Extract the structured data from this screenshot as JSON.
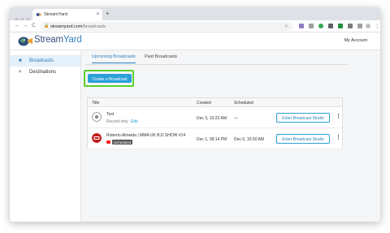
{
  "browser": {
    "tab_title": "StreamYard",
    "tab_close": "×",
    "new_tab": "+",
    "url_domain": "streamyard.com",
    "url_path": "/broadcasts",
    "back": "←",
    "forward": "→",
    "reload": "C",
    "star": "☆"
  },
  "header": {
    "logo_part1": "Stream",
    "logo_part2": "Yard",
    "account": "My Account"
  },
  "sidebar": {
    "items": [
      {
        "label": "Broadcasts",
        "icon": "video-camera-icon"
      },
      {
        "label": "Destinations",
        "icon": "share-icon"
      }
    ]
  },
  "main": {
    "tabs": [
      {
        "label": "Upcoming Broadcasts"
      },
      {
        "label": "Past Broadcasts"
      }
    ],
    "create_button": "Create a Broadcast",
    "table": {
      "headers": [
        "Title",
        "Created",
        "Scheduled"
      ],
      "rows": [
        {
          "title": "Test",
          "subtitle": "Record only",
          "edit": "Edit",
          "created": "Dec 3, 10:22 AM",
          "scheduled": "—",
          "action": "Enter Broadcast Studio",
          "more": "⋮"
        },
        {
          "title": "Roberto Almeida | MMA UK BJJ SHOW #14",
          "badge": "Scheduled",
          "created": "Dec 1, 09:14 PM",
          "scheduled": "Dec 6, 10:30 AM",
          "action": "Enter Broadcast Studio",
          "more": "⋮"
        }
      ]
    }
  },
  "colors": {
    "accent": "#2b9fd8",
    "highlight_border": "#5ad12b",
    "sidebar_active_bg": "#e4f0fa"
  }
}
